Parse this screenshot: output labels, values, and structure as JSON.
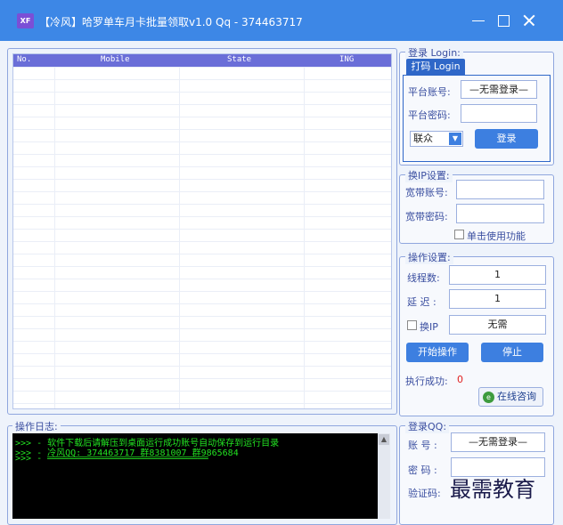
{
  "window": {
    "icon_text": "XF",
    "title": "【冷风】哈罗单车月卡批量领取v1.0    Qq - 374463717"
  },
  "grid": {
    "columns": [
      "No.",
      "Mobile",
      "State",
      "ING"
    ]
  },
  "login": {
    "legend": "登录 Login:",
    "tab": "打码 Login",
    "account_label": "平台账号:",
    "account_value": "—无需登录—",
    "password_label": "平台密码:",
    "password_value": "",
    "provider": "联众",
    "login_button": "登录"
  },
  "ip": {
    "legend": "换IP设置:",
    "account_label": "宽带账号:",
    "account_value": "",
    "password_label": "宽带密码:",
    "password_value": "",
    "checkbox_label": "单击使用功能"
  },
  "ops": {
    "legend": "操作设置:",
    "threads_label": "线程数:",
    "threads_value": "1",
    "delay_label": "延 迟 :",
    "delay_value": "1",
    "switch_ip_label": "换IP",
    "switch_ip_value": "无需",
    "start_button": "开始操作",
    "stop_button": "停止",
    "success_label": "执行成功:",
    "success_value": "0",
    "consult_button": "在线咨询"
  },
  "log": {
    "legend": "操作日志:",
    "lines": [
      ">>> - 软件下载后请解压到桌面运行成功账号自动保存到运行目录",
      ">>> - 冷风QQ: 374463717 群8381007 群9865684",
      ">>> - ══════════════════════════════"
    ]
  },
  "qq": {
    "legend": "登录QQ:",
    "account_label": "账 号 :",
    "account_value": "—无需登录—",
    "password_label": "密 码 :",
    "password_value": "",
    "captcha_label": "验证码:"
  },
  "watermark": "最需教育"
}
